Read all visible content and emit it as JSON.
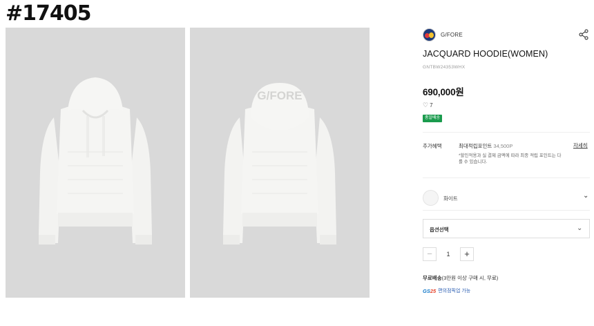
{
  "overlay": {
    "id_label": "#17405"
  },
  "product": {
    "brand": "G/FORE",
    "title": "JACQUARD HOODIE(WOMEN)",
    "sku": "GNTBW24353WHX",
    "price": "690,000원",
    "likes": "7",
    "badge": "총알배송"
  },
  "benefits": {
    "label": "추가혜택",
    "value_prefix": "최대적립포인트",
    "value_amount": "34,500P",
    "detail_link": "자세히",
    "note": "*할인적용과 실 결제 금액에 따라 최종 적립 포인트는 다를 수 있습니다."
  },
  "color": {
    "label": "화이트"
  },
  "option": {
    "label": "옵션선택"
  },
  "quantity": {
    "minus": "−",
    "value": "1",
    "plus": "+"
  },
  "shipping": {
    "label": "무료배송",
    "detail": "(3만원 이상 구매 시, 무료)",
    "pickup_text": "편의점픽업 가능",
    "gs_logo": "GS",
    "gs_logo_num": "25"
  },
  "icons": {
    "share": "share-icon",
    "heart": "heart-icon",
    "chevron": "chevron-down-icon"
  },
  "colors": {
    "badge_green": "#1a9b4d",
    "image_bg": "#d9d9d9",
    "pickup_blue": "#2c5fb3"
  }
}
